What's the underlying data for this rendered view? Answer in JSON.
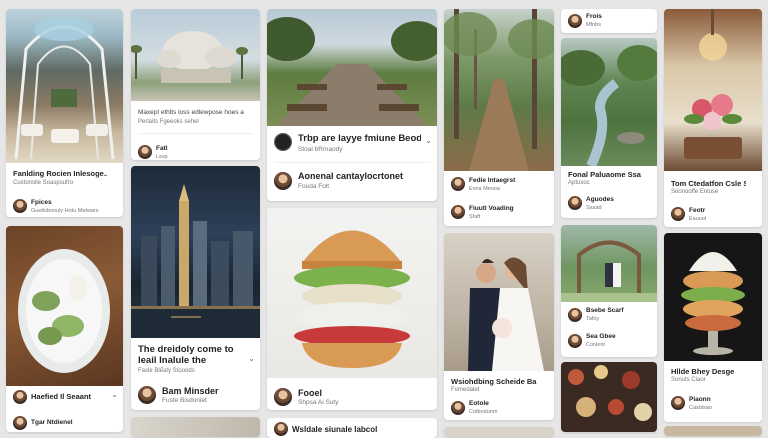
{
  "colors": {
    "background": "#e6e6e6",
    "card": "#ffffff",
    "text": "#222222",
    "muted": "#777777"
  },
  "menu_glyph": "⌄",
  "cards": {
    "hall": {
      "title": "Fanlding Rocien Inlesoge...",
      "subtitle": "Custonslle Soaspsufro",
      "user": "Fpices",
      "user_sub": "Guetlsboouly Hotu Metwars"
    },
    "dome": {
      "caption": "Maxepl ethlts loss edlewpose hoes aad",
      "caption2": "Perlaits Fgeeoks sehel",
      "user": "Fatl",
      "user_sub": "Lsvp"
    },
    "boardwalk": {
      "title": "Trbp are layye fmiune Beoder",
      "subtitle": "Stoal bRmaody",
      "user": "Aonenal cantaylocrtonet",
      "user_sub": "Fouda Folt"
    },
    "path": {
      "user1": "Fedie Intaegrst",
      "user1_sub": "Evna Meooa",
      "user2": "Fiuutl Voading",
      "user2_sub": "Sfaft"
    },
    "profile_top": {
      "user": "Frois",
      "user_sub": "Mfnbs"
    },
    "stream": {
      "title": "Fonal Paluaome Ssastion",
      "subtitle": "Aptuxoc",
      "user": "Aguodes",
      "user_sub": "Ssaad"
    },
    "bouquet": {
      "title": "Tom Ctedatfon Csle Ssaisfy...",
      "subtitle": "Soonooffe Enluse",
      "user": "Feotr",
      "user_sub": "Eauuol"
    },
    "city": {
      "title": "The dreidoly come to leail Inalule the coogbest",
      "subtitle": "Fasle Bleaty Stooods",
      "user": "Bam Minsder",
      "user_sub": "Fuste Bisdoniet"
    },
    "burger": {
      "user": "Fooel",
      "user_sub": "Shpsa Ai Suty"
    },
    "wedding": {
      "title": "Wsiohdbing Scheide Ba Ral bq...",
      "subtitle": "Fomedalet",
      "user": "Eotole",
      "user_sub": "Cotbodunm"
    },
    "gazebo": {
      "user1": "Bsebe Scarf",
      "user1_sub": "Tafoy",
      "user2": "Sea Gbee",
      "user2_sub": "Conlent"
    },
    "food_plate": {
      "title": "Haefied Il Seaant",
      "user": "Tgar Ntdienel"
    },
    "dessert": {
      "title": "Hllde Bhey Desge",
      "subtitle": "Sonuts Ciaor",
      "user": "Piaonn",
      "user_sub": "Casblsao"
    },
    "partial": {
      "text": "Wsldale siunale labcol"
    }
  }
}
